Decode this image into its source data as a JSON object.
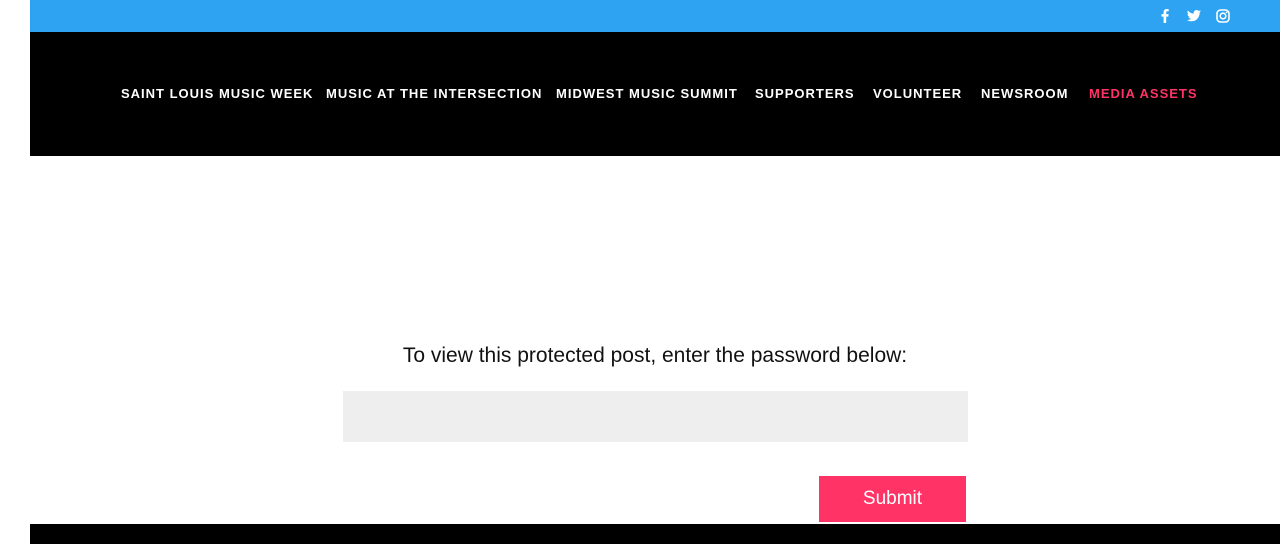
{
  "social": {
    "icons": [
      "facebook-icon",
      "twitter-icon",
      "instagram-icon"
    ]
  },
  "nav": {
    "items": [
      {
        "label": "SAINT LOUIS MUSIC WEEK"
      },
      {
        "label": "MUSIC AT THE INTERSECTION"
      },
      {
        "label": "MIDWEST MUSIC SUMMIT"
      },
      {
        "label": "SUPPORTERS"
      },
      {
        "label": "VOLUNTEER"
      },
      {
        "label": "NEWSROOM"
      },
      {
        "label": "MEDIA ASSETS",
        "active": true
      }
    ]
  },
  "main": {
    "prompt": "To view this protected post, enter the password below:",
    "password_value": "",
    "submit_label": "Submit"
  },
  "colors": {
    "top_bar": "#2ea3f2",
    "header": "#000000",
    "accent": "#ff3366",
    "input_bg": "#eeeeee"
  }
}
